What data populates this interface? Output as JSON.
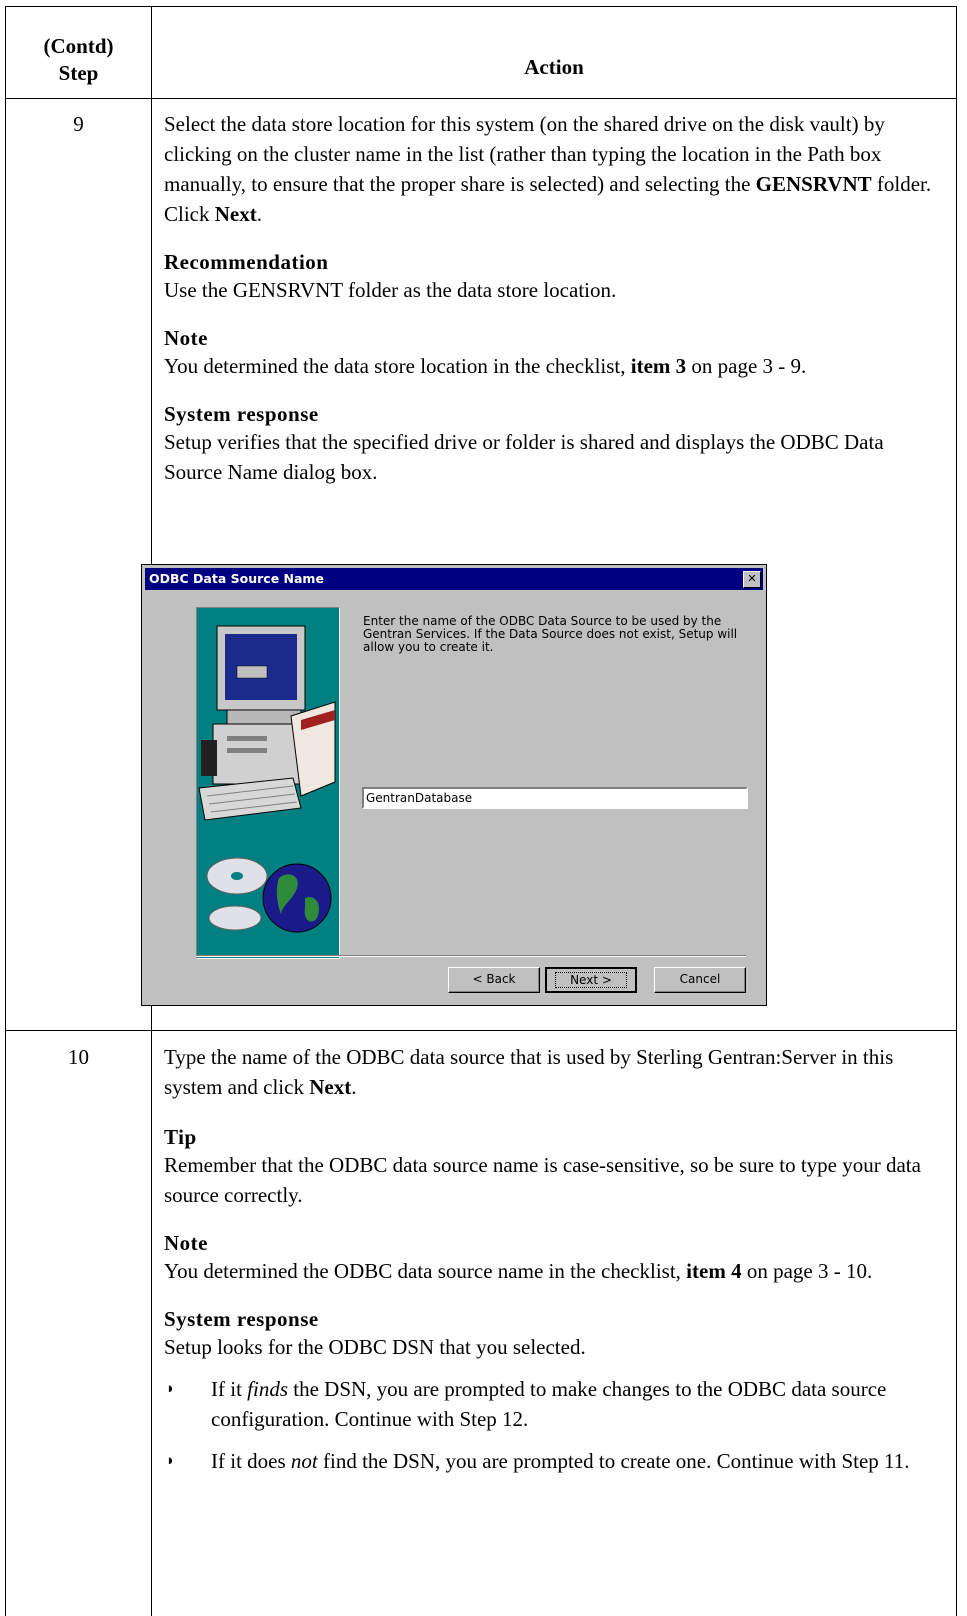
{
  "header": {
    "step_line1": "(Contd)",
    "step_line2": "Step",
    "action": "Action"
  },
  "step9": {
    "number": "9",
    "p1_a": "Select the data store location for this system (on the shared drive on the disk vault) by clicking on the cluster name in the list (rather than typing the location in the Path box manually, to ensure that the proper share is selected) and selecting the ",
    "p1_b": "GENSRVNT",
    "p1_c": " folder. Click ",
    "p1_d": "Next",
    "p1_e": ".",
    "rec_heading": "Recommendation",
    "rec_text": "Use the GENSRVNT folder as the data store location.",
    "note_heading": "Note",
    "note_a": "You determined the data store location in the checklist, ",
    "note_b": "item 3",
    "note_c": " on page 3 - 9.",
    "resp_heading": "System response",
    "resp_text": "Setup verifies that the specified drive or folder is shared and displays the ODBC Data Source Name dialog box."
  },
  "dialog": {
    "title": "ODBC Data Source Name",
    "close_glyph": "✕",
    "message": "Enter the name of the ODBC Data Source to be used by the Gentran Services.      If the Data Source does not exist, Setup will allow you to create it.",
    "input_value": "GentranDatabase",
    "back_label": "< Back",
    "next_label": "Next >",
    "cancel_label": "Cancel"
  },
  "step10": {
    "number": "10",
    "p1_a": "Type the name of the ODBC data source that is used by Sterling Gentran:Server in this system and click ",
    "p1_b": "Next",
    "p1_c": ".",
    "tip_heading": "Tip",
    "tip_text": "Remember that the ODBC data source name is case-sensitive, so be sure to type your data source correctly.",
    "note_heading": "Note",
    "note_a": "You determined the ODBC data source name in the checklist, ",
    "note_b": "item 4",
    "note_c": " on page 3 - 10.",
    "resp_heading": "System response",
    "resp_text": "Setup looks for the ODBC DSN that you selected.",
    "bullet_marker": "◗",
    "b1_a": "If it ",
    "b1_b": "finds",
    "b1_c": " the DSN, you are prompted to make changes to the ODBC data source configuration. Continue with Step 12.",
    "b2_a": "If it does ",
    "b2_b": "not",
    "b2_c": " find the DSN, you are prompted to create one. Continue with Step 11."
  },
  "colors": {
    "titlebar": "#000080",
    "dialog_face": "#c0c0c0",
    "art_bg": "#008080"
  }
}
